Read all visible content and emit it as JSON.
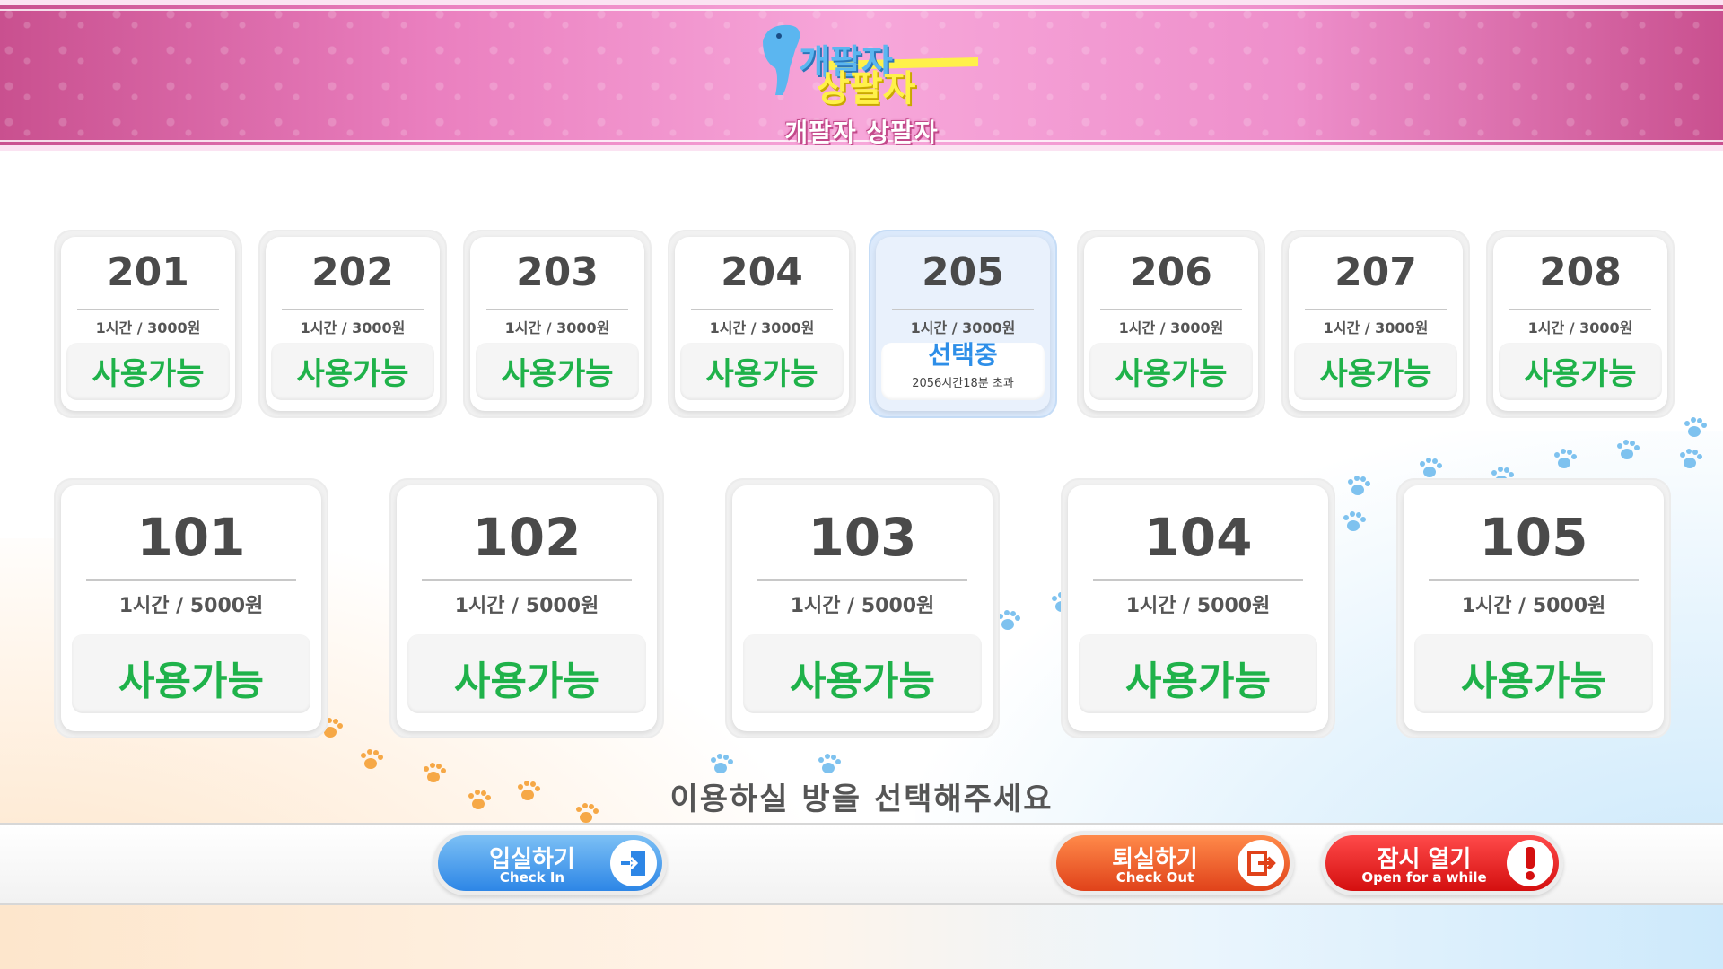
{
  "header": {
    "logo_main_1": "개팔자",
    "logo_main_2": "상팔자",
    "logo_sub": "개팔자 상팔자"
  },
  "rooms_upper": [
    {
      "number": "201",
      "price": "1시간 / 3000원",
      "status": "사용가능",
      "sub": ""
    },
    {
      "number": "202",
      "price": "1시간 / 3000원",
      "status": "사용가능",
      "sub": ""
    },
    {
      "number": "203",
      "price": "1시간 / 3000원",
      "status": "사용가능",
      "sub": ""
    },
    {
      "number": "204",
      "price": "1시간 / 3000원",
      "status": "사용가능",
      "sub": ""
    },
    {
      "number": "205",
      "price": "1시간 / 3000원",
      "status": "선택중",
      "sub": "2056시간18분 초과",
      "selected": true
    },
    {
      "number": "206",
      "price": "1시간 / 3000원",
      "status": "사용가능",
      "sub": ""
    },
    {
      "number": "207",
      "price": "1시간 / 3000원",
      "status": "사용가능",
      "sub": ""
    },
    {
      "number": "208",
      "price": "1시간 / 3000원",
      "status": "사용가능",
      "sub": ""
    }
  ],
  "rooms_lower": [
    {
      "number": "101",
      "price": "1시간 / 5000원",
      "status": "사용가능"
    },
    {
      "number": "102",
      "price": "1시간 / 5000원",
      "status": "사용가능"
    },
    {
      "number": "103",
      "price": "1시간 / 5000원",
      "status": "사용가능"
    },
    {
      "number": "104",
      "price": "1시간 / 5000원",
      "status": "사용가능"
    },
    {
      "number": "105",
      "price": "1시간 / 5000원",
      "status": "사용가능"
    }
  ],
  "prompt": "이용하실 방을 선택해주세요",
  "buttons": {
    "check_in": {
      "label": "입실하기",
      "en": "Check In",
      "icon": "door-enter-icon"
    },
    "check_out": {
      "label": "퇴실하기",
      "en": "Check Out",
      "icon": "door-exit-icon"
    },
    "open_while": {
      "label": "잠시 열기",
      "en": "Open for a while",
      "icon": "exclamation-icon"
    }
  },
  "colors": {
    "available": "#1fb24a",
    "selected": "#2d8ee8",
    "header_pink": "#ea7fbf"
  }
}
